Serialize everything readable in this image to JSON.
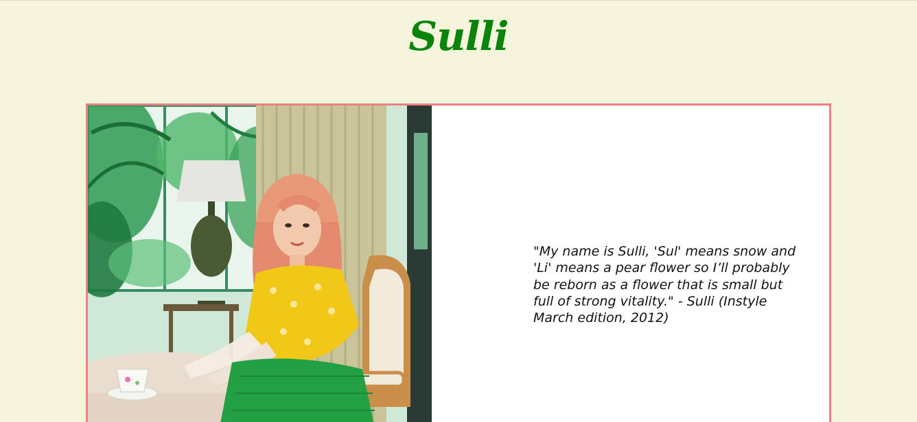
{
  "site": {
    "title": "Sulli"
  },
  "profile_card": {
    "photo_alt": "Sulli sitting at a table in a yellow blouse and green skirt",
    "quote": "\"My name is Sulli, 'Sul' means snow and 'Li' means a pear flower so I’ll probably be reborn as a flower that is small but full of strong vitality.\" - Sulli (Instyle March edition, 2012)"
  },
  "colors": {
    "page_background": "#f5f5dc",
    "title": "#0a840a",
    "card_border": "#f08080",
    "card_background": "#ffffff"
  }
}
